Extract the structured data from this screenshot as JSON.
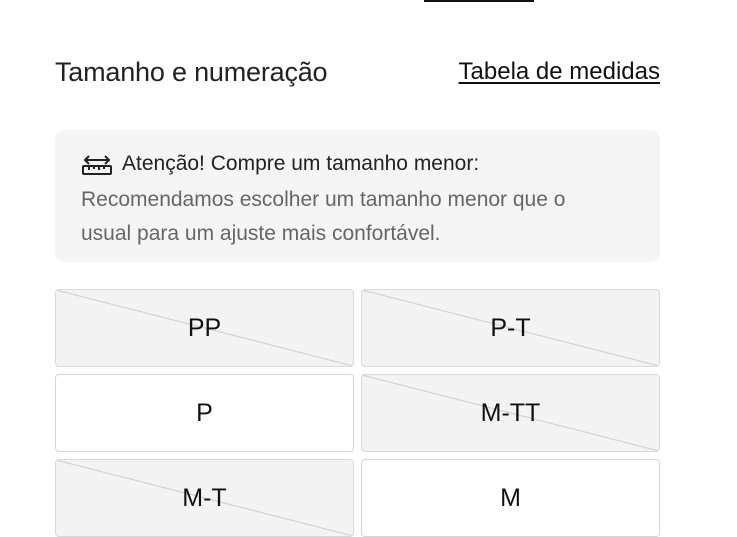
{
  "size_section": {
    "title": "Tamanho e numeração",
    "size_guide_link": "Tabela de medidas"
  },
  "fit_notice": {
    "icon": "ruler-icon",
    "title": "Atenção! Compre um tamanho menor:",
    "body": "Recomendamos escolher um tamanho menor que o usual para um ajuste mais confortável."
  },
  "sizes": [
    {
      "label": "PP",
      "available": false
    },
    {
      "label": "P-T",
      "available": false
    },
    {
      "label": "P",
      "available": true
    },
    {
      "label": "M-TT",
      "available": false
    },
    {
      "label": "M-T",
      "available": false
    },
    {
      "label": "M",
      "available": true
    }
  ],
  "colors": {
    "text": "#222222",
    "muted_text": "#666666",
    "notice_background": "#f5f5f5",
    "unavailable_background": "#f3f3f3",
    "border": "#d6d6d6"
  }
}
